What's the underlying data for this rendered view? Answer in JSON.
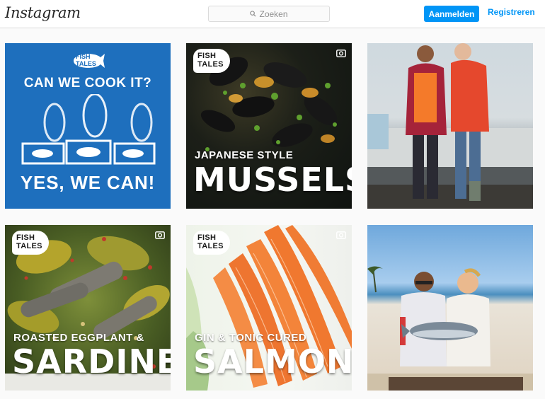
{
  "header": {
    "logo": "Instagram",
    "search_placeholder": "Zoeken",
    "login_label": "Aanmelden",
    "register_label": "Registreren"
  },
  "posts": [
    {
      "badge": "FISH TALES",
      "headline": "CAN WE COOK IT?",
      "footline": "YES, WE CAN!"
    },
    {
      "badge": "FISH TALES",
      "caption_small": "JAPANESE STYLE",
      "caption_big": "MUSSELS",
      "icon": "carousel-icon"
    },
    {
      "description_icon": "photo"
    },
    {
      "badge": "FISH TALES",
      "caption_small": "ROASTED EGGPLANT &",
      "caption_big": "SARDINES",
      "icon": "carousel-icon"
    },
    {
      "badge": "FISH TALES",
      "caption_small": "GIN & TONIC CURED",
      "caption_big": "SALMON",
      "icon": "carousel-icon"
    },
    {
      "description_icon": "photo"
    }
  ],
  "colors": {
    "accent": "#0095f6",
    "header_bg": "#ffffff",
    "page_bg": "#fafafa",
    "tile1_blue": "#1e6fbd"
  }
}
